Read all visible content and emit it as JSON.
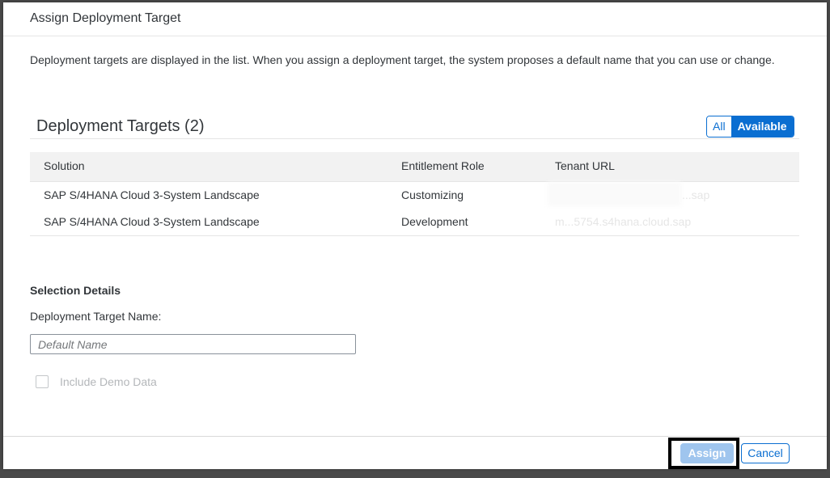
{
  "dialog": {
    "title": "Assign Deployment Target",
    "intro": "Deployment targets are displayed in the list. When you assign a deployment target, the system proposes a default name that you can use or change."
  },
  "table": {
    "title": "Deployment Targets (2)",
    "filter": {
      "all_label": "All",
      "available_label": "Available",
      "selected": "Available"
    },
    "columns": [
      "Solution",
      "Entitlement Role",
      "Tenant URL"
    ],
    "rows": [
      {
        "solution": "SAP S/4HANA Cloud 3-System Landscape",
        "role": "Customizing",
        "url": "...sap"
      },
      {
        "solution": "SAP S/4HANA Cloud 3-System Landscape",
        "role": "Development",
        "url": "m...5754.s4hana.cloud.sap"
      }
    ]
  },
  "details": {
    "section_title": "Selection Details",
    "name_label": "Deployment Target Name:",
    "name_value": "",
    "name_placeholder": "Default Name",
    "demo_label": "Include Demo Data",
    "demo_checked": false
  },
  "footer": {
    "assign_label": "Assign",
    "cancel_label": "Cancel"
  },
  "colors": {
    "accent": "#0a6ed1",
    "disabled_primary": "#9fc5ee",
    "overlay": "#4a4a4a"
  }
}
